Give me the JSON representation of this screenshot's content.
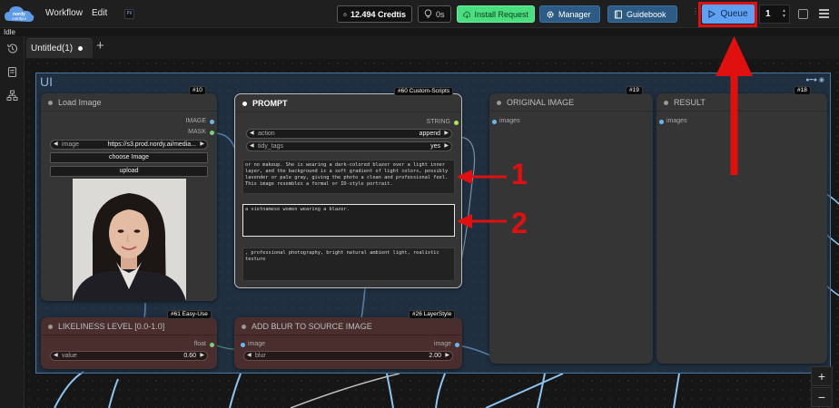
{
  "app": {
    "logo_text": "nordy comfyui",
    "status": "Idle"
  },
  "menu": {
    "workflow": "Workflow",
    "edit": "Edit",
    "pv_badge": "PV"
  },
  "toolbar": {
    "credits": "12.494 Credtis",
    "timer": "0s",
    "install_request": "Install Request",
    "manager": "Manager",
    "guidebook": "Guidebook",
    "queue": "Queue",
    "batch_count": "1"
  },
  "tabs": [
    {
      "label": "Untitled(1)"
    }
  ],
  "group": {
    "title": "UI"
  },
  "nodes": {
    "load_image": {
      "id": "#10",
      "title": "Load Image",
      "outputs": [
        "IMAGE",
        "MASK"
      ],
      "image_label": "image",
      "image_value": "https://s3.prod.nordy.ai/media...",
      "choose_button": "choose Image",
      "upload_button": "upload"
    },
    "prompt": {
      "id": "#60 Custom-Scripts",
      "title": "PROMPT",
      "output": "STRING",
      "action_label": "action",
      "action_value": "append",
      "tidy_label": "tidy_tags",
      "tidy_value": "yes",
      "text_1": "or no makeup. She is wearing a dark-colored blazer over a light inner layer, and the background is a soft gradient of light colors, possibly lavender or pale gray, giving the photo a clean and professional feel. This image resembles a formal or ID-style portrait.",
      "text_2": "a vietnamese women wearing a blazer.",
      "text_3": ", professional photography, bright natural ambient light, realistic texture"
    },
    "original_image": {
      "id": "#19",
      "title": "ORIGINAL IMAGE",
      "input": "images"
    },
    "result": {
      "id": "#18",
      "title": "RESULT",
      "input": "images"
    },
    "likeliness": {
      "id": "#61 Easy-Use",
      "title": "LIKELINESS LEVEL [0.0-1.0]",
      "output": "float",
      "value_label": "value",
      "value": "0.60"
    },
    "blur": {
      "id": "#26 LayerStyle",
      "title": "ADD BLUR TO SOURCE IMAGE",
      "input": "image",
      "output": "image",
      "blur_label": "blur",
      "blur_value": "2.00"
    }
  },
  "annotations": {
    "one": "1",
    "two": "2"
  },
  "zoom": {
    "in": "+",
    "out": "−"
  },
  "colors": {
    "queue": "#5fa0f2",
    "install": "#4ade80",
    "blue_btn": "#2c5b86",
    "annotation": "#e01010",
    "group": "#4a78a0"
  }
}
